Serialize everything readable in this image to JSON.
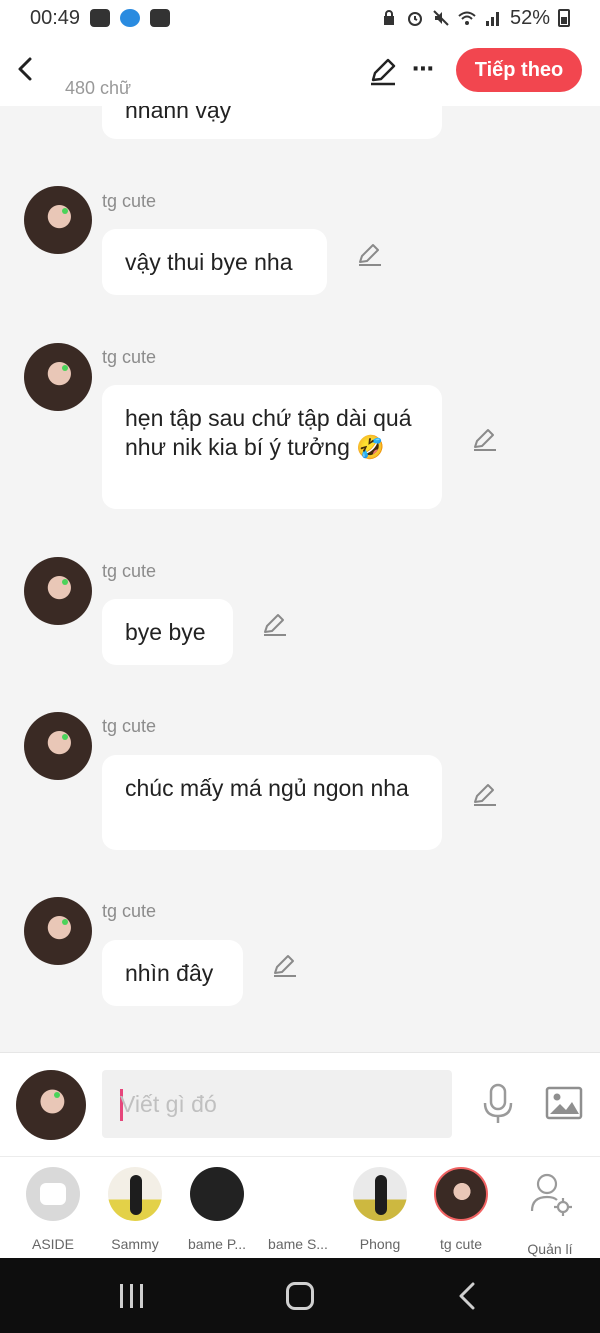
{
  "status_bar": {
    "time": "00:49",
    "battery": "52%"
  },
  "header": {
    "word_count": "480 chữ",
    "next_label": "Tiếp theo"
  },
  "chat": {
    "partial_message": "nhanh vậy",
    "messages": [
      {
        "sender": "tg cute",
        "text": "vậy thui bye nha"
      },
      {
        "sender": "tg cute",
        "text": "hẹn tập sau chứ tập dài quá như nik kia bí ý tưởng 🤣"
      },
      {
        "sender": "tg cute",
        "text": "bye bye"
      },
      {
        "sender": "tg cute",
        "text": "chúc mấy má ngủ ngon nha"
      },
      {
        "sender": "tg cute",
        "text": "nhìn đây"
      }
    ]
  },
  "composer": {
    "placeholder": "Viết gì đó"
  },
  "characters": [
    {
      "name": "ASIDE"
    },
    {
      "name": "Sammy"
    },
    {
      "name": "bame P..."
    },
    {
      "name": "bame S..."
    },
    {
      "name": "Phong"
    },
    {
      "name": "tg cute"
    },
    {
      "name": "Quản lí"
    }
  ],
  "colors": {
    "accent": "#f2464f",
    "caret": "#e6467b"
  }
}
